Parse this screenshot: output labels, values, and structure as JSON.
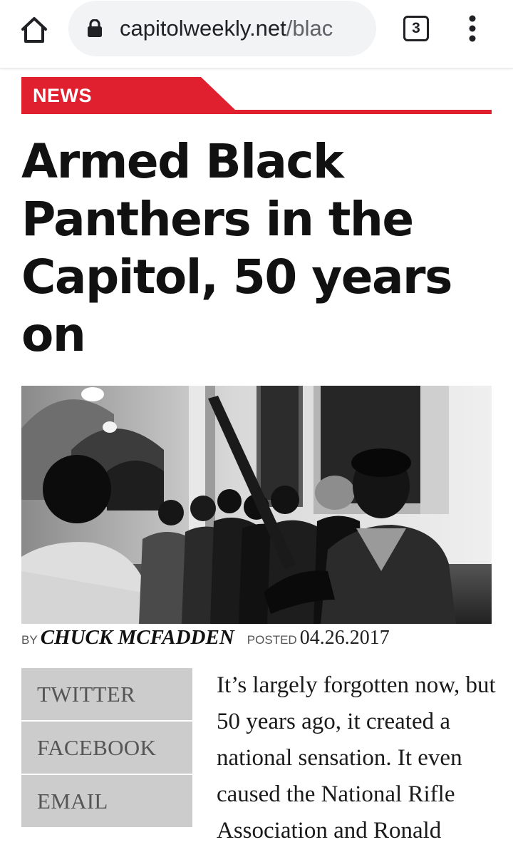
{
  "browser": {
    "url_domain": "capitolweekly.net",
    "url_path": "/blac",
    "tab_count": "3",
    "icons": {
      "home": "home-icon",
      "lock": "lock-icon",
      "tabs": "tab-switcher-icon",
      "menu": "more-vert-icon"
    }
  },
  "article": {
    "category": "NEWS",
    "headline": "Armed Black Panthers in the Capitol, 50 years on",
    "byline": {
      "by_label": "BY",
      "author": "CHUCK MCFADDEN",
      "posted_label": "POSTED",
      "date": "04.26.2017"
    },
    "share": [
      {
        "label": "TWITTER"
      },
      {
        "label": "FACEBOOK"
      },
      {
        "label": "EMAIL"
      }
    ],
    "body_text": "It’s largely forgotten now, but 50 years ago, it created a national sensation. It even caused the National Rifle Association and Ronald"
  },
  "colors": {
    "accent_red": "#e0202e",
    "share_bg": "#cccccc",
    "share_text": "#555555",
    "url_bar_bg": "#f1f3f4"
  }
}
